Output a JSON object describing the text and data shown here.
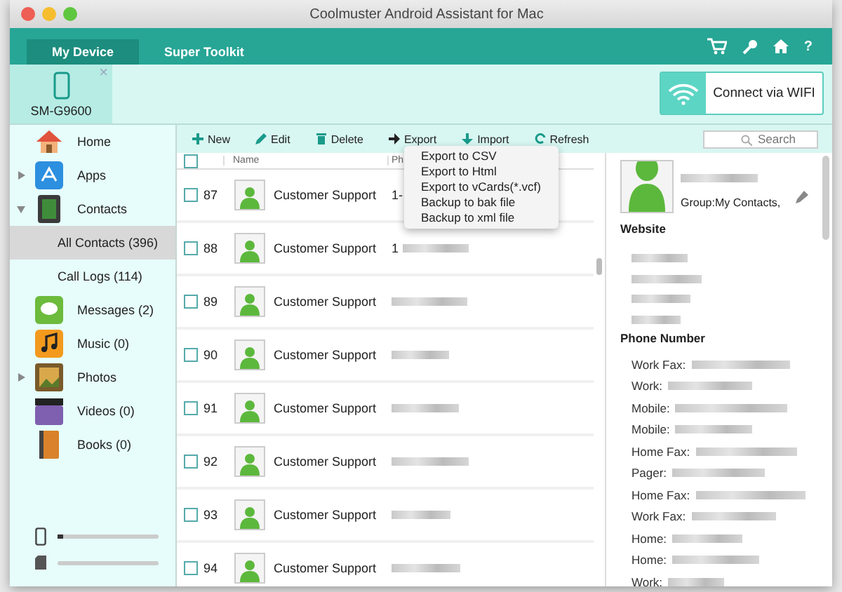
{
  "window": {
    "title": "Coolmuster Android Assistant for Mac"
  },
  "tabs": [
    {
      "label": "My Device",
      "selected": true
    },
    {
      "label": "Super Toolkit",
      "selected": false
    }
  ],
  "help": "?",
  "device": {
    "name": "SM-G9600",
    "close": "×"
  },
  "wifi_button": "Connect via WIFI",
  "sidebar": {
    "items": [
      {
        "label": "Home"
      },
      {
        "label": "Apps",
        "expanded": false
      },
      {
        "label": "Contacts",
        "expanded": true,
        "children": [
          {
            "label": "All Contacts (396)",
            "selected": true
          },
          {
            "label": "Call Logs (114)",
            "selected": false
          }
        ]
      },
      {
        "label": "Messages (2)"
      },
      {
        "label": "Music (0)"
      },
      {
        "label": "Photos",
        "expanded": false
      },
      {
        "label": "Videos (0)"
      },
      {
        "label": "Books (0)"
      }
    ],
    "storage": [
      {
        "level": 0.05
      },
      {
        "level": 0.0
      }
    ]
  },
  "toolbar": [
    "New",
    "Edit",
    "Delete",
    "Export",
    "Import",
    "Refresh"
  ],
  "search": {
    "placeholder": "Search"
  },
  "export_menu": [
    "Export to CSV",
    "Export to Html",
    "Export to vCards(*.vcf)",
    "Backup to bak file",
    "Backup to xml file"
  ],
  "table": {
    "columns": [
      "Name",
      "Ph"
    ],
    "select_all_checked": false,
    "rows": [
      {
        "number": "87",
        "name": "Customer Support",
        "checked": false,
        "phone": "1-"
      },
      {
        "number": "88",
        "name": "Customer Support",
        "checked": false,
        "phone": "1"
      },
      {
        "number": "89",
        "name": "Customer Support",
        "checked": false
      },
      {
        "number": "90",
        "name": "Customer Support",
        "checked": false
      },
      {
        "number": "91",
        "name": "Customer Support",
        "checked": false
      },
      {
        "number": "92",
        "name": "Customer Support",
        "checked": false
      },
      {
        "number": "93",
        "name": "Customer Support",
        "checked": false
      },
      {
        "number": "94",
        "name": "Customer Support",
        "checked": false
      }
    ]
  },
  "detail": {
    "group": "Group:My Contacts,",
    "website_heading": "Website",
    "phone_heading": "Phone Number",
    "phones": [
      "Work Fax:",
      "Work:",
      "Mobile:",
      "Mobile:",
      "Home Fax:",
      "Pager:",
      "Home Fax:",
      "Work Fax:",
      "Home:",
      "Home:",
      "Work:"
    ]
  }
}
